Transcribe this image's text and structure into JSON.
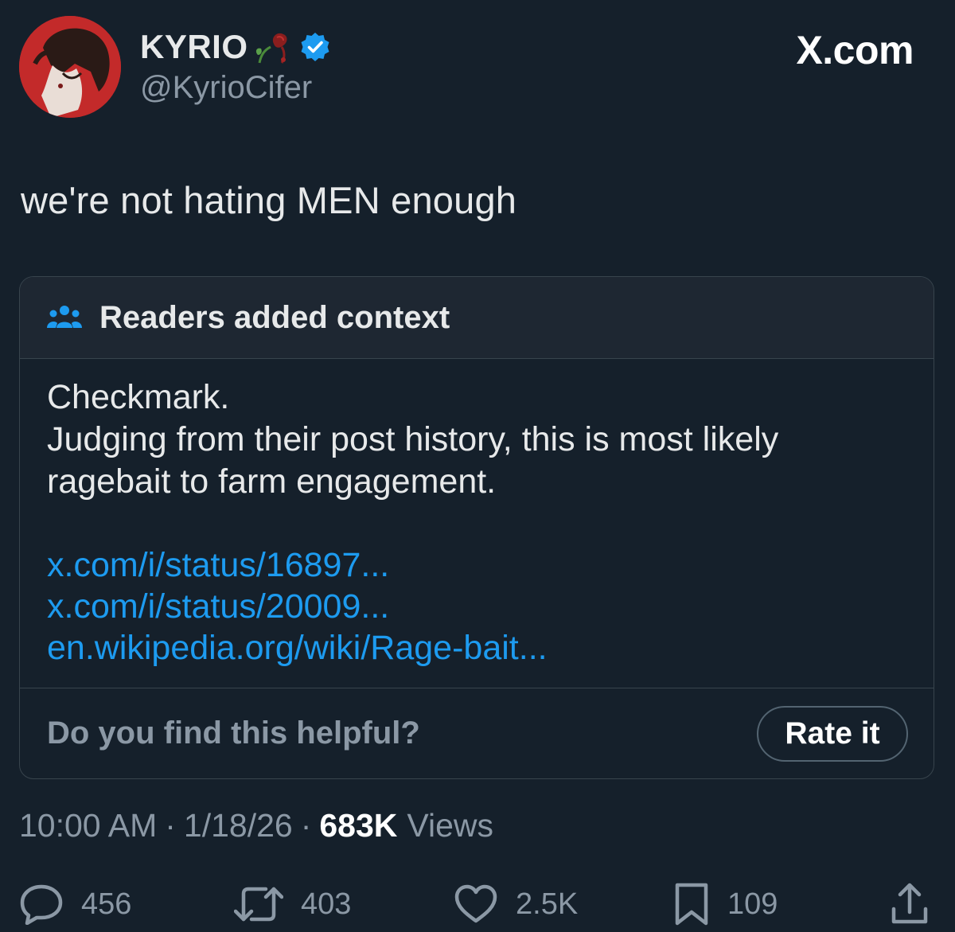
{
  "author": {
    "display_name": "KYRIO",
    "handle": "@KyrioCifer",
    "verified": true,
    "emoji": "wilted-rose-icon"
  },
  "brand": "X.com",
  "tweet": {
    "text": "we're not hating MEN enough"
  },
  "community_note": {
    "title": "Readers added context",
    "body_lines": [
      "Checkmark.",
      "Judging from their post history, this is most likely",
      "ragebait to farm engagement."
    ],
    "links": [
      "x.com/i/status/16897...",
      "x.com/i/status/20009...",
      "en.wikipedia.org/wiki/Rage-bait..."
    ],
    "question": "Do you find this helpful?",
    "rate_label": "Rate it"
  },
  "meta": {
    "time": "10:00 AM",
    "date": "1/18/26",
    "separator": "·",
    "views_count": "683K",
    "views_label": "Views"
  },
  "actions": {
    "replies": "456",
    "reposts": "403",
    "likes": "2.5K",
    "bookmarks": "109"
  },
  "colors": {
    "background": "#15202b",
    "link": "#1d9bf0",
    "muted": "#8b98a5",
    "verified": "#1d9bf0",
    "avatar_bg": "#c32a2a"
  }
}
